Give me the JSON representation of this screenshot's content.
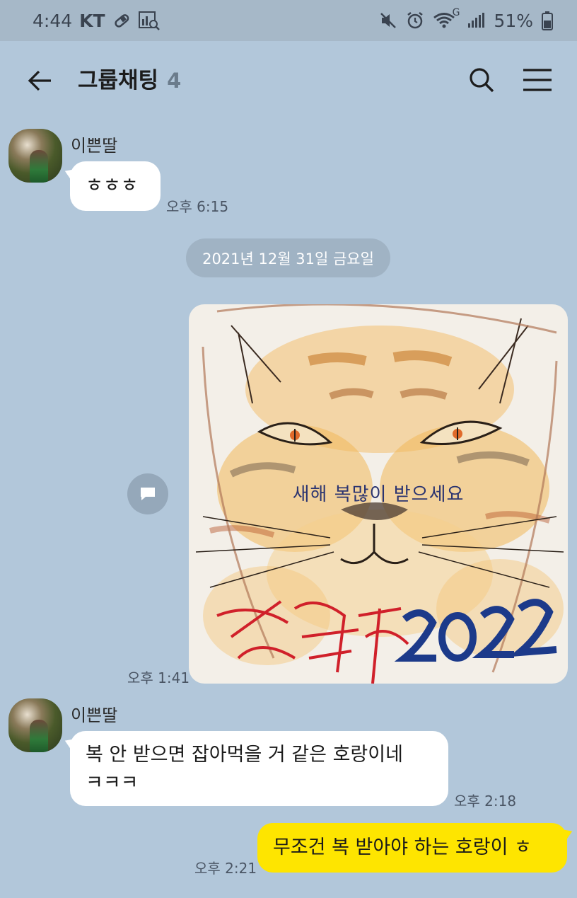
{
  "status_bar": {
    "time": "4:44",
    "carrier": "KT",
    "battery": "51%",
    "network": "G"
  },
  "header": {
    "title": "그룹채팅",
    "member_count": "4"
  },
  "messages": [
    {
      "sender": "이쁜딸",
      "text": "ㅎㅎㅎ",
      "time": "오후 6:15"
    },
    {
      "date_divider": "2021년 12월 31일 금요일"
    },
    {
      "image_caption": "새해 복많이 받으세요",
      "image_text_year": "2022",
      "time": "오후 1:41"
    },
    {
      "sender": "이쁜딸",
      "text_line1": "복 안 받으면 잡아먹을 거 같은 호랑이네",
      "text_line2": "ㅋㅋㅋ",
      "time": "오후 2:18"
    },
    {
      "text": "무조건 복 받아야 하는 호랑이 ㅎ",
      "time": "오후 2:21"
    }
  ],
  "colors": {
    "chat_background": "#b2c7da",
    "my_bubble": "#fee500",
    "other_bubble": "#ffffff"
  },
  "icons": {
    "back": "back-arrow-icon",
    "search": "search-icon",
    "menu": "hamburger-menu-icon",
    "share": "share-icon"
  }
}
